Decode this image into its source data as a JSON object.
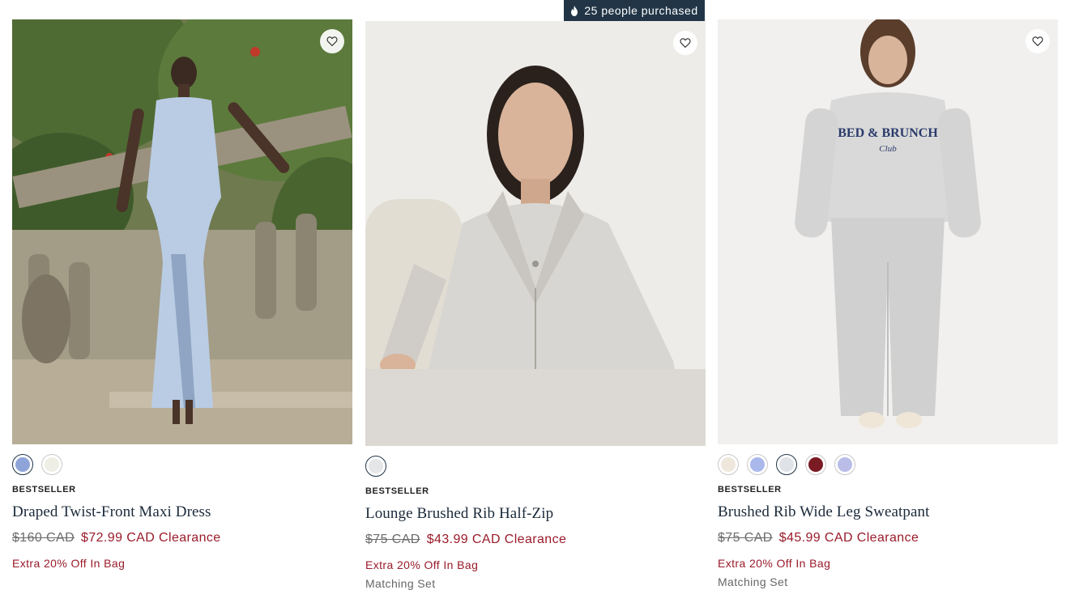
{
  "purchase_banner": {
    "text": "25 people purchased",
    "icon": "flame-icon"
  },
  "products": [
    {
      "name": "Draped Twist-Front Maxi Dress",
      "badge": "BESTSELLER",
      "original_price": "$160 CAD",
      "sale_price": "$72.99 CAD Clearance",
      "promo": "Extra 20% Off In Bag",
      "extra": "",
      "swatches": [
        "#8ea4d8",
        "#eeeee4"
      ],
      "selected_swatch": 0
    },
    {
      "name": "Lounge Brushed Rib Half-Zip",
      "badge": "BESTSELLER",
      "original_price": "$75 CAD",
      "sale_price": "$43.99 CAD Clearance",
      "promo": "Extra 20% Off In Bag",
      "extra": "Matching Set",
      "swatches": [
        "#e4e6e8"
      ],
      "selected_swatch": 0
    },
    {
      "name": "Brushed Rib Wide Leg Sweatpant",
      "badge": "BESTSELLER",
      "original_price": "$75 CAD",
      "sale_price": "$45.99 CAD Clearance",
      "promo": "Extra 20% Off In Bag",
      "extra": "Matching Set",
      "swatches": [
        "#efe7dc",
        "#aab8ec",
        "#dfe2e6",
        "#7a1a22",
        "#b9bde8"
      ],
      "selected_swatch": 2
    }
  ],
  "colors": {
    "accent": "#9a1b2a",
    "navy": "#213547"
  }
}
